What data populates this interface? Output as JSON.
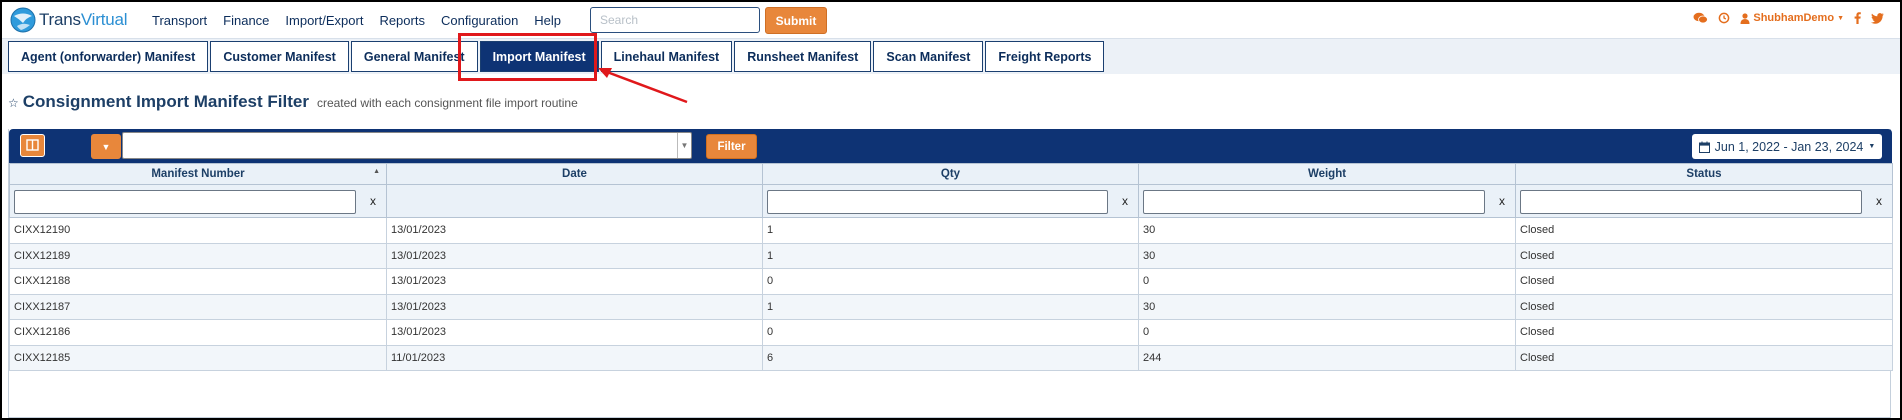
{
  "brand": {
    "part1": "Trans",
    "part2": "Virtual"
  },
  "menu": [
    "Transport",
    "Finance",
    "Import/Export",
    "Reports",
    "Configuration",
    "Help"
  ],
  "search": {
    "placeholder": "Search",
    "value": ""
  },
  "submit_label": "Submit",
  "user": {
    "name": "ShubhamDemo"
  },
  "tabs": [
    {
      "label": "Agent (onforwarder) Manifest",
      "active": false
    },
    {
      "label": "Customer Manifest",
      "active": false
    },
    {
      "label": "General Manifest",
      "active": false
    },
    {
      "label": "Import Manifest",
      "active": true
    },
    {
      "label": "Linehaul Manifest",
      "active": false
    },
    {
      "label": "Runsheet Manifest",
      "active": false
    },
    {
      "label": "Scan Manifest",
      "active": false
    },
    {
      "label": "Freight Reports",
      "active": false
    }
  ],
  "heading": {
    "title": "Consignment Import Manifest Filter",
    "subtitle": "created with each consignment file import routine"
  },
  "toolbar": {
    "filter_label": "Filter",
    "date_range": "Jun 1, 2022 - Jan 23, 2024"
  },
  "table": {
    "columns": [
      "Manifest Number",
      "Date",
      "Qty",
      "Weight",
      "Status"
    ],
    "rows": [
      [
        "CIXX12190",
        "13/01/2023",
        "1",
        "30",
        "Closed"
      ],
      [
        "CIXX12189",
        "13/01/2023",
        "1",
        "30",
        "Closed"
      ],
      [
        "CIXX12188",
        "13/01/2023",
        "0",
        "0",
        "Closed"
      ],
      [
        "CIXX12187",
        "13/01/2023",
        "1",
        "30",
        "Closed"
      ],
      [
        "CIXX12186",
        "13/01/2023",
        "0",
        "0",
        "Closed"
      ],
      [
        "CIXX12185",
        "11/01/2023",
        "6",
        "244",
        "Closed"
      ]
    ]
  },
  "colors": {
    "navy": "#0e3374",
    "accent_orange": "#e8873b",
    "highlight_red": "#e0181b"
  },
  "icons": [
    "globe-logo-icon",
    "chat-icon",
    "history-icon",
    "user-icon",
    "facebook-icon",
    "twitter-icon",
    "columns-icon",
    "calendar-icon",
    "sort-icon",
    "clear-x-icon"
  ]
}
